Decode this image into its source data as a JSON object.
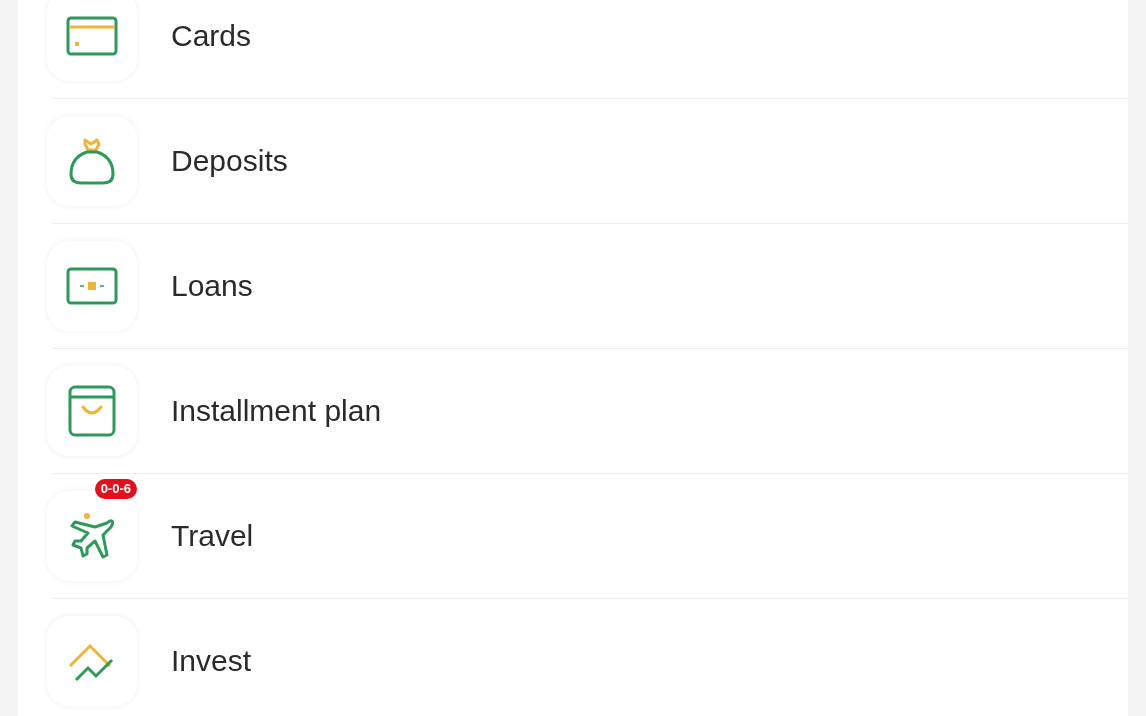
{
  "menu": {
    "items": [
      {
        "kind": "card",
        "label": "Cards"
      },
      {
        "kind": "deposit",
        "label": "Deposits"
      },
      {
        "kind": "loan",
        "label": "Loans"
      },
      {
        "kind": "installment",
        "label": "Installment plan"
      },
      {
        "kind": "travel",
        "label": "Travel",
        "badge": "0-0-6"
      },
      {
        "kind": "invest",
        "label": "Invest"
      }
    ]
  }
}
